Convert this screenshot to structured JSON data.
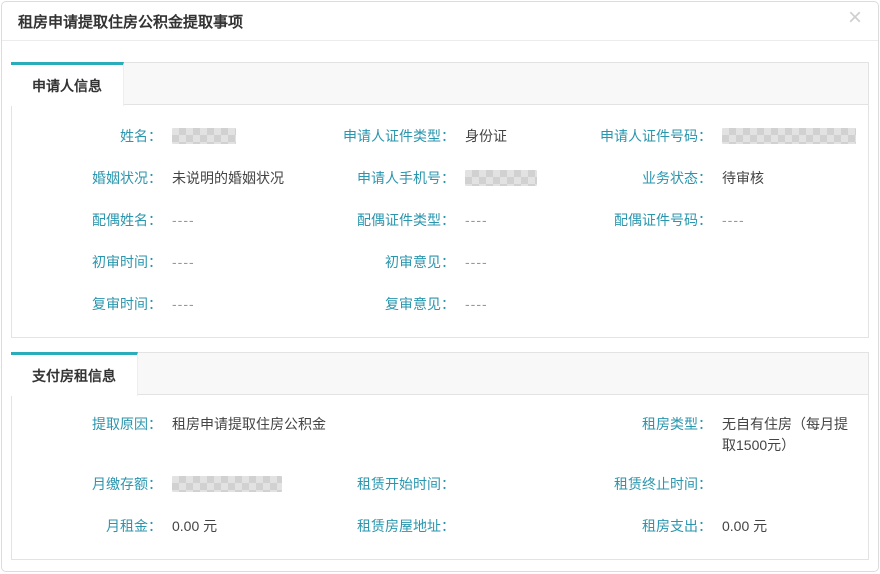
{
  "dialog": {
    "title": "租房申请提取住房公积金提取事项",
    "close_glyph": "×"
  },
  "colors": {
    "accent_teal": "#2aacba",
    "label_text": "#2a96ae",
    "value_text": "#444444",
    "header_strip_bg": "#f8f8f8",
    "border": "#e3e3e3"
  },
  "applicant_section": {
    "tab": "申请人信息",
    "fields": {
      "name": {
        "label": "姓名：",
        "value_redacted": true
      },
      "cert_type": {
        "label": "申请人证件类型：",
        "value": "身份证"
      },
      "cert_no": {
        "label": "申请人证件号码：",
        "value_redacted": true
      },
      "marital": {
        "label": "婚姻状况：",
        "value": "未说明的婚姻状况"
      },
      "phone": {
        "label": "申请人手机号：",
        "value_redacted": true
      },
      "status": {
        "label": "业务状态：",
        "value": "待审核"
      },
      "spouse_name": {
        "label": "配偶姓名：",
        "value": "----"
      },
      "spouse_cert_type": {
        "label": "配偶证件类型：",
        "value": "----"
      },
      "spouse_cert_no": {
        "label": "配偶证件号码：",
        "value": "----"
      },
      "first_review_time": {
        "label": "初审时间：",
        "value": "----"
      },
      "first_review_opinion": {
        "label": "初审意见：",
        "value": "----"
      },
      "second_review_time": {
        "label": "复审时间：",
        "value": "----"
      },
      "second_review_opinion": {
        "label": "复审意见：",
        "value": "----"
      }
    }
  },
  "rent_section": {
    "tab": "支付房租信息",
    "fields": {
      "withdraw_reason": {
        "label": "提取原因：",
        "value": "租房申请提取住房公积金"
      },
      "rent_type": {
        "label": "租房类型：",
        "value": "无自有住房（每月提取1500元）"
      },
      "monthly_deposit": {
        "label": "月缴存额：",
        "value_redacted": true
      },
      "lease_start": {
        "label": "租赁开始时间：",
        "value": ""
      },
      "lease_end": {
        "label": "租赁终止时间：",
        "value": ""
      },
      "monthly_rent": {
        "label": "月租金：",
        "value": "0.00 元"
      },
      "lease_address": {
        "label": "租赁房屋地址：",
        "value": ""
      },
      "rent_expense": {
        "label": "租房支出：",
        "value": "0.00 元"
      }
    }
  }
}
